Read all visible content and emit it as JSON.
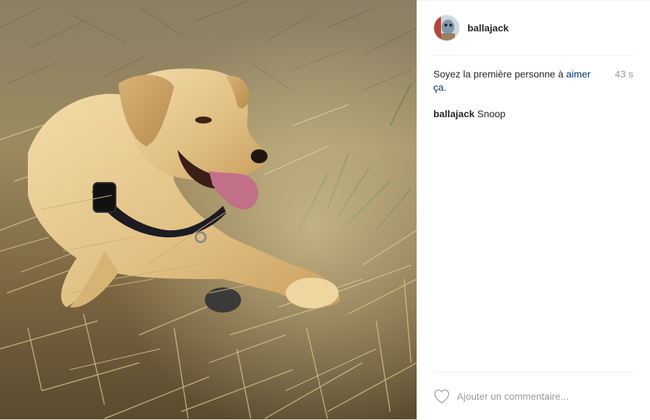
{
  "post": {
    "username": "ballajack",
    "likes": {
      "prefix": "Soyez la première personne à ",
      "link": "aimer ça",
      "suffix": "."
    },
    "timestamp": "43 s",
    "caption": {
      "username": "ballajack",
      "text": "Snoop"
    }
  },
  "comment": {
    "placeholder": "Ajouter un commentaire..."
  },
  "icons": {
    "heart": "heart-outline-icon",
    "avatar": "profile-picture"
  },
  "colors": {
    "link": "#003569",
    "muted": "#999999",
    "divider": "#efefef",
    "text": "#262626"
  }
}
